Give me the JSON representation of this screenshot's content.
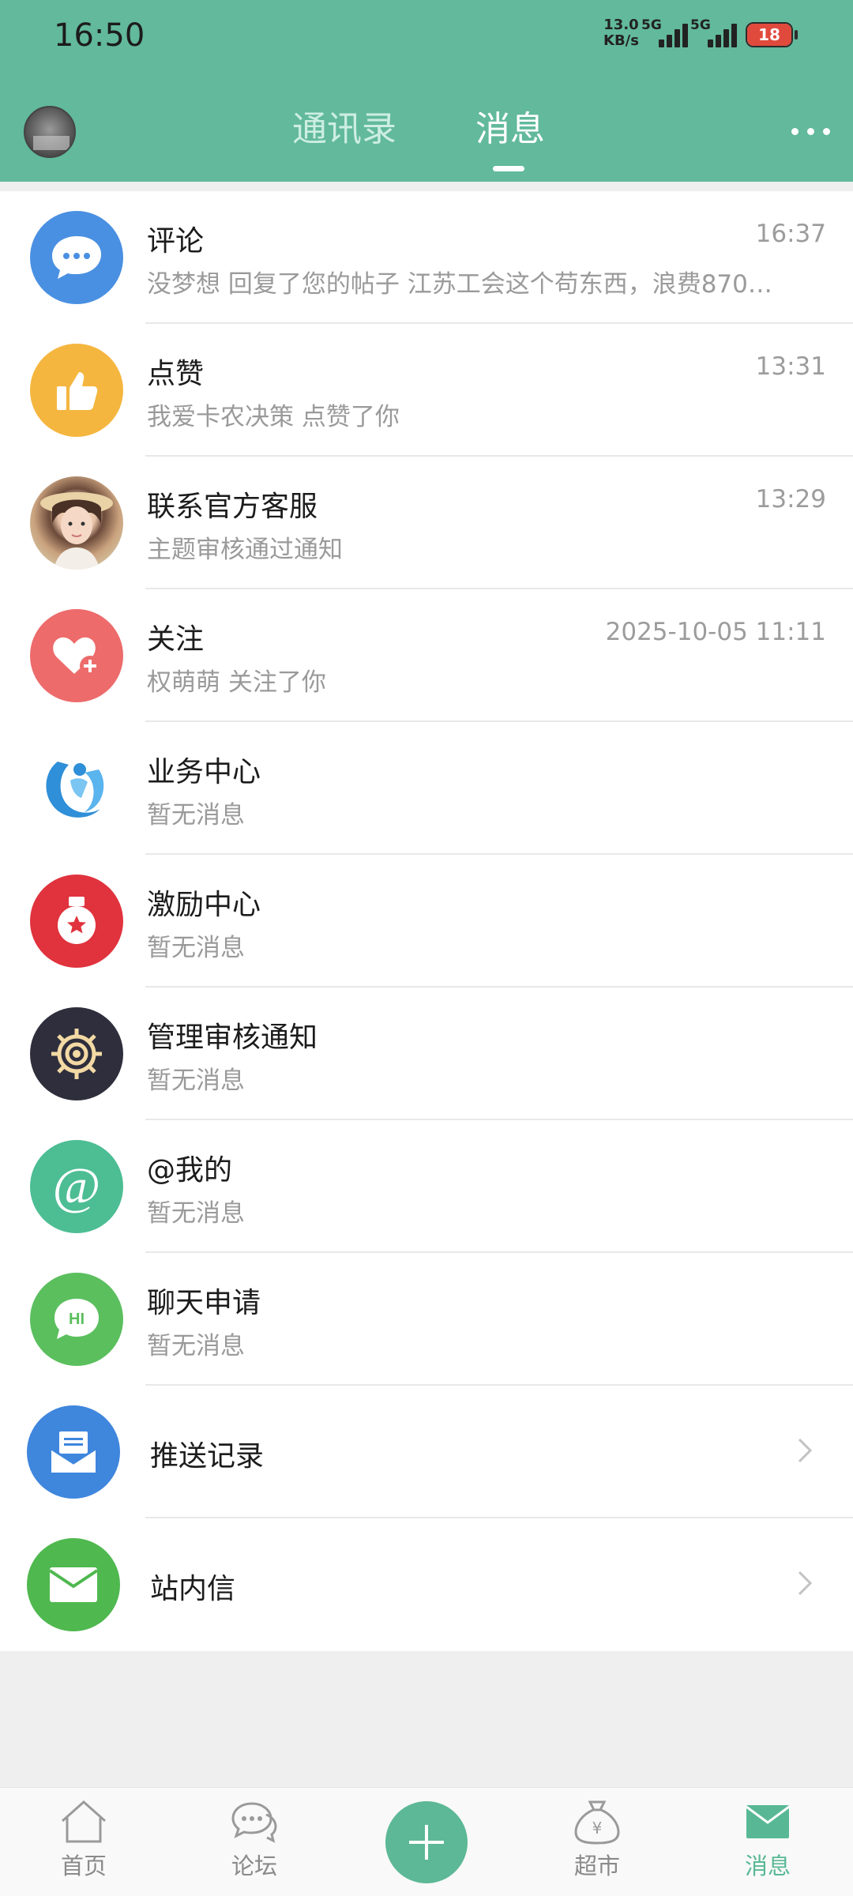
{
  "status_bar": {
    "time": "16:50",
    "net_speed_value": "13.0",
    "net_speed_unit": "KB/s",
    "signal_1": "5G",
    "signal_2": "5G",
    "battery": "18"
  },
  "header": {
    "tab_contacts": "通讯录",
    "tab_messages": "消息",
    "active_tab": "消息",
    "bg_color": "#62b99c"
  },
  "messages": [
    {
      "title": "评论",
      "subtitle": "没梦想 回复了您的帖子 江苏工会这个苟东西，浪费870…",
      "time": "16:37",
      "icon": "comment-icon"
    },
    {
      "title": "点赞",
      "subtitle": "我爱卡农决策 点赞了你",
      "time": "13:31",
      "icon": "thumbs-up-icon"
    },
    {
      "title": "联系官方客服",
      "subtitle": "主题审核通过通知",
      "time": "13:29",
      "icon": "support-avatar"
    },
    {
      "title": "关注",
      "subtitle": "权萌萌 关注了你",
      "time": "2025-10-05 11:11",
      "icon": "heart-plus-icon"
    },
    {
      "title": "业务中心",
      "subtitle": "暂无消息",
      "time": "",
      "icon": "business-center-icon"
    },
    {
      "title": "激励中心",
      "subtitle": "暂无消息",
      "time": "",
      "icon": "medal-icon"
    },
    {
      "title": "管理审核通知",
      "subtitle": "暂无消息",
      "time": "",
      "icon": "gear-icon"
    },
    {
      "title": "@我的",
      "subtitle": "暂无消息",
      "time": "",
      "icon": "at-icon"
    },
    {
      "title": "聊天申请",
      "subtitle": "暂无消息",
      "time": "",
      "icon": "chat-hi-icon"
    }
  ],
  "links": [
    {
      "title": "推送记录",
      "icon": "push-records-icon"
    },
    {
      "title": "站内信",
      "icon": "mail-icon"
    }
  ],
  "bottom_nav": {
    "home": "首页",
    "forum": "论坛",
    "market": "超市",
    "messages": "消息",
    "active": "消息"
  }
}
